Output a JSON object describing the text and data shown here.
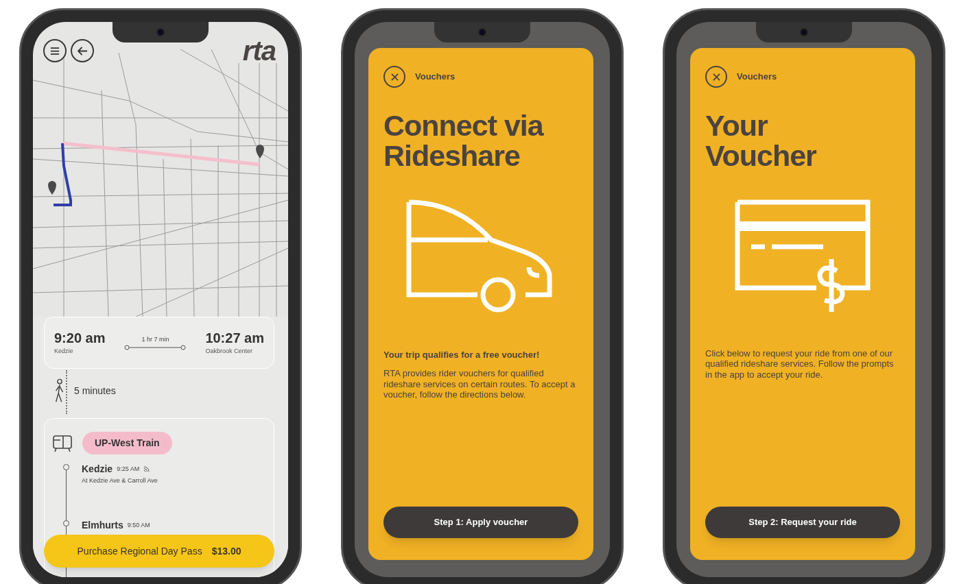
{
  "phones": [
    {
      "kind": "trip",
      "logo": "rta",
      "trip": {
        "depart_time": "9:20 am",
        "depart_stop": "Kedzie",
        "duration": "1 hr 7 min",
        "arrive_time": "10:27 am",
        "arrive_stop": "Oakbrook Center"
      },
      "walk": "5 minutes",
      "route": {
        "badge": "UP-West Train",
        "stops": [
          {
            "name": "Kedzie",
            "time": "9:25 AM",
            "realtime": true,
            "address": "At Kedzie Ave & Carroll Ave"
          },
          {
            "name": "Elmhurts",
            "time": "9:50 AM",
            "realtime": false
          }
        ]
      },
      "purchase": {
        "label": "Purchase Regional Day Pass",
        "price": "$13.00"
      }
    },
    {
      "kind": "voucher",
      "header": "Vouchers",
      "title_lines": [
        "Connect via",
        "Rideshare"
      ],
      "illustration": {
        "kind": "car"
      },
      "lead": "Your trip qualifies for a free voucher!",
      "body": "RTA provides rider vouchers for qualified rideshare services on certain routes. To accept a voucher, follow the directions below.",
      "button": "Step 1: Apply voucher"
    },
    {
      "kind": "voucher",
      "header": "Vouchers",
      "title_lines": [
        "Your",
        "Voucher"
      ],
      "illustration": {
        "kind": "card"
      },
      "body": "Click below to request your ride from one of our qualified rideshare services. Follow the prompts in the app to accept your ride.",
      "button": "Step 2: Request your ride"
    }
  ]
}
